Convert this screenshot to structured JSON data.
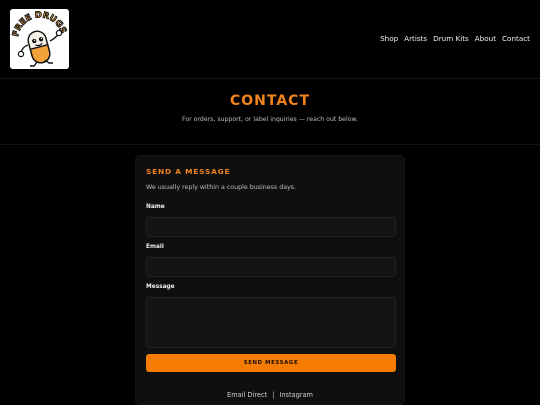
{
  "brand": {
    "logo_text": "FREE DRUGS",
    "accent": "#f2841b"
  },
  "nav": {
    "items": [
      "Shop",
      "Artists",
      "Drum Kits",
      "About",
      "Contact"
    ]
  },
  "hero": {
    "title": "CONTACT",
    "subtitle": "For orders, support, or label inquiries — reach out below."
  },
  "form": {
    "heading": "SEND A MESSAGE",
    "subheading": "We usually reply within a couple business days.",
    "name_label": "Name",
    "name_value": "",
    "email_label": "Email",
    "email_value": "",
    "message_label": "Message",
    "message_value": "",
    "submit_label": "SEND MESSAGE",
    "button_color": "#f57c00"
  },
  "links": {
    "email": "Email Direct",
    "separator": "|",
    "instagram": "Instagram"
  }
}
